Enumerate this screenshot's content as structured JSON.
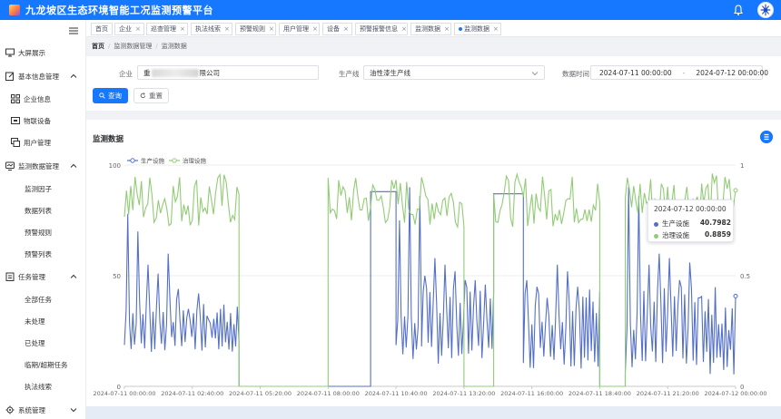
{
  "app": {
    "title": "九龙坡区生态环境智能工况监测预警平台"
  },
  "sidebar": {
    "items": [
      {
        "label": "大屏展示",
        "icon": "monitor-icon"
      },
      {
        "label": "基本信息管理",
        "icon": "edit-icon",
        "expanded": true
      },
      {
        "label": "企业信息",
        "icon": "grid-icon"
      },
      {
        "label": "物联设备",
        "icon": "device-icon"
      },
      {
        "label": "用户管理",
        "icon": "user-screen-icon"
      },
      {
        "label": "监测数据管理",
        "icon": "data-monitor-icon",
        "expanded": true
      },
      {
        "label": "监测因子"
      },
      {
        "label": "数据列表"
      },
      {
        "label": "预警规则"
      },
      {
        "label": "预警列表"
      },
      {
        "label": "任务管理",
        "icon": "task-icon",
        "expanded": true
      },
      {
        "label": "全部任务"
      },
      {
        "label": "未处理"
      },
      {
        "label": "已处理"
      },
      {
        "label": "临期/超期任务"
      },
      {
        "label": "执法线索"
      },
      {
        "label": "系统管理",
        "icon": "settings-icon",
        "expanded": false
      }
    ]
  },
  "tabs": [
    {
      "label": "首页",
      "closable": false
    },
    {
      "label": "企业",
      "closable": true
    },
    {
      "label": "巡查管理",
      "closable": true
    },
    {
      "label": "执法线索",
      "closable": true
    },
    {
      "label": "预警规则",
      "closable": true
    },
    {
      "label": "用户管理",
      "closable": true
    },
    {
      "label": "设备",
      "closable": true
    },
    {
      "label": "预警报警信息",
      "closable": true
    },
    {
      "label": "监测数据",
      "closable": true
    },
    {
      "label": "监测数据",
      "closable": true,
      "active": true
    }
  ],
  "breadcrumb": [
    "首页",
    "监测数据管理",
    "监测数据"
  ],
  "filters": {
    "company_label": "企业",
    "company_value_prefix": "重",
    "company_value_suffix": "限公司",
    "line_label": "生产线",
    "line_value": "油性漆生产线",
    "time_label": "数据时间",
    "start": "2024-07-11 00:00:00",
    "range_sep": "-",
    "end": "2024-07-12 00:00:00",
    "query_button": "查询",
    "reset_button": "重置"
  },
  "section": {
    "title": "监测数据"
  },
  "tooltip": {
    "time": "2024-07-12 00:00:00",
    "rows": [
      {
        "name": "生产设施",
        "value": "40.7982"
      },
      {
        "name": "治理设施",
        "value": "0.8859"
      }
    ]
  },
  "colors": {
    "primary": "#1677ff",
    "production": "#5470c6",
    "treatment": "#91cc75"
  },
  "chart_data": {
    "type": "line",
    "legend": [
      "生产设施",
      "治理设施"
    ],
    "legend_position": "top-left",
    "x_ticks": [
      "2024-07-11 00:00:00",
      "2024-07-11 02:40:00",
      "2024-07-11 05:20:00",
      "2024-07-11 08:00:00",
      "2024-07-11 10:40:00",
      "2024-07-11 13:20:00",
      "2024-07-11 16:00:00",
      "2024-07-11 18:40:00",
      "2024-07-11 21:20:00",
      "2024-07-12 00:00:00"
    ],
    "x_range_minutes": [
      0,
      1440
    ],
    "y_left": {
      "range": [
        0,
        100
      ],
      "ticks": [
        "0",
        "50",
        "100"
      ]
    },
    "y_right": {
      "range": [
        0,
        1
      ],
      "ticks": [
        "0",
        "0.5",
        "1"
      ]
    },
    "grid": "horizontal",
    "series": [
      {
        "name": "生产设施",
        "axis": "left",
        "segments": [
          {
            "from": 0,
            "to": 270,
            "pattern": "oscillating",
            "base": [
              15,
              40
            ],
            "peaks": [
              78,
              70,
              55,
              51,
              60,
              44,
              35,
              42,
              30
            ]
          },
          {
            "from": 270,
            "to": 480,
            "pattern": "flat",
            "value": 0
          },
          {
            "from": 480,
            "to": 580,
            "pattern": "flat",
            "value": 0
          },
          {
            "from": 580,
            "to": 640,
            "pattern": "plateau",
            "value": 88
          },
          {
            "from": 640,
            "to": 700,
            "pattern": "oscillating",
            "base": [
              10,
              40
            ],
            "peaks": [
              75,
              90,
              86,
              55
            ]
          },
          {
            "from": 700,
            "to": 870,
            "pattern": "oscillating",
            "base": [
              10,
              45
            ],
            "peaks": [
              50,
              58,
              55,
              52,
              48,
              48,
              46
            ]
          },
          {
            "from": 870,
            "to": 940,
            "pattern": "plateau",
            "value": 87
          },
          {
            "from": 940,
            "to": 1120,
            "pattern": "oscillating",
            "base": [
              8,
              45
            ],
            "peaks": [
              48,
              45,
              40,
              55,
              52,
              45
            ]
          },
          {
            "from": 1120,
            "to": 1180,
            "pattern": "flat",
            "value": 0
          },
          {
            "from": 1180,
            "to": 1440,
            "pattern": "oscillating",
            "base": [
              5,
              45
            ],
            "peaks": [
              90,
              86,
              55,
              60,
              58,
              48,
              56,
              40
            ]
          }
        ],
        "last_value": 40.7982
      },
      {
        "name": "治理设施",
        "axis": "right",
        "segments": [
          {
            "from": 0,
            "to": 270,
            "pattern": "noisy",
            "range": [
              0.72,
              0.97
            ]
          },
          {
            "from": 270,
            "to": 480,
            "pattern": "flat",
            "value": 0
          },
          {
            "from": 480,
            "to": 800,
            "pattern": "noisy",
            "range": [
              0.72,
              0.95
            ]
          },
          {
            "from": 800,
            "to": 870,
            "pattern": "flat",
            "value": 0
          },
          {
            "from": 870,
            "to": 1120,
            "pattern": "noisy",
            "range": [
              0.72,
              0.96
            ]
          },
          {
            "from": 1120,
            "to": 1180,
            "pattern": "flat",
            "value": 0
          },
          {
            "from": 1180,
            "to": 1440,
            "pattern": "noisy",
            "range": [
              0.72,
              0.97
            ]
          }
        ],
        "last_value": 0.8859
      }
    ]
  }
}
